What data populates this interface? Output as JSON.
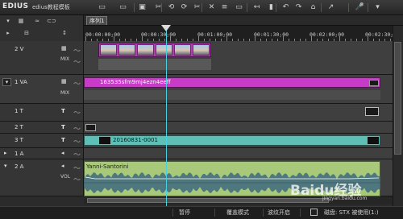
{
  "app": {
    "title": "EDIUS",
    "project_name": "edius教程模板"
  },
  "toolbar": {
    "icons": [
      "new-project-icon",
      "open-project-icon",
      "save-icon",
      "settings-icon",
      "undo-icon",
      "redo-icon",
      "cut-icon",
      "delete-icon",
      "ripple-icon",
      "add-clip-icon",
      "insert-icon",
      "overwrite-icon",
      "mark-in-icon",
      "mark-out-icon",
      "snap-icon",
      "render-icon",
      "microphone-icon",
      "help-icon"
    ],
    "glyphs": [
      "▭",
      "▭",
      "▣",
      "✂",
      "⟲",
      "⟳",
      "✂",
      "✕",
      "≡",
      "▭",
      "↤",
      "▮",
      "↶",
      "↷",
      "⌂",
      "↗",
      "🎤",
      "▾"
    ]
  },
  "sequence": {
    "tab_label": "序列1",
    "timecodes": [
      "00:00:00;00",
      "00:00:30;00",
      "00:01:00;00",
      "00:01:30;00",
      "00:02:00;00",
      "00:02:30;00"
    ]
  },
  "tracks": [
    {
      "label": "2 V",
      "type_icon": "▦",
      "tag": "MIX"
    },
    {
      "label": "1 VA",
      "type_icon": "▦",
      "tag": "MIX"
    },
    {
      "label": "1 T",
      "type_icon": "T",
      "tag": ""
    },
    {
      "label": "2 T",
      "type_icon": "T",
      "tag": ""
    },
    {
      "label": "3 T",
      "type_icon": "T",
      "tag": ""
    },
    {
      "label": "1 A",
      "type_icon": "◂",
      "tag": ""
    },
    {
      "label": "2 A",
      "type_icon": "◂",
      "tag": "VOL"
    }
  ],
  "clips": {
    "video_clip_label": "163535sfm9mj4ezn4eeff",
    "title_clip_label": "20160831-0001",
    "audio_clip_label": "Yanni-Santorini"
  },
  "status": {
    "pause": "暂停",
    "overwrite_mode": "覆盖模式",
    "ripple_on": "波纹开启",
    "disk": "磁盘: STX 被使用(1:)"
  },
  "watermark": {
    "text": "Baidu经验",
    "url": "jingyan.baidu.com"
  },
  "colors": {
    "video_clip": "#c83ac8",
    "title_clip": "#5ebfb6",
    "audio_clip": "#a8c87a",
    "playhead": "#48d1e0"
  }
}
